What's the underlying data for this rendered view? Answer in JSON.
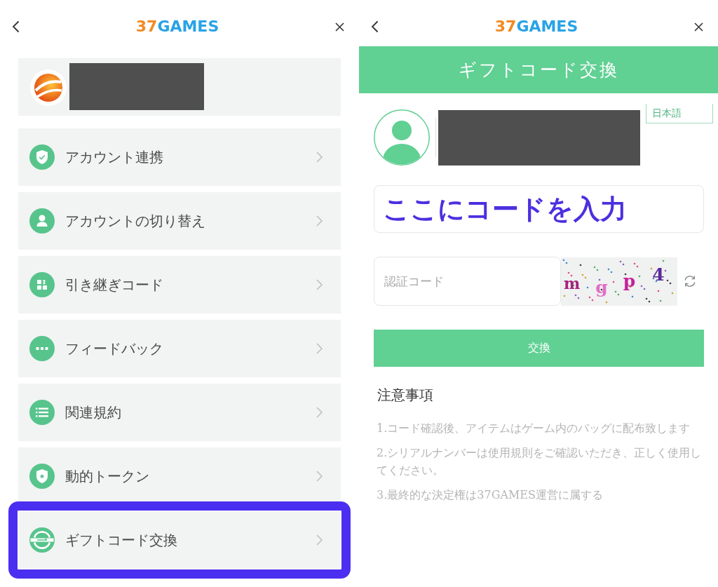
{
  "left_screen": {
    "header": {
      "logo": {
        "number": "37",
        "word": "GAMES"
      }
    },
    "menu_items": [
      {
        "label": "アカウント連携",
        "highlighted": false
      },
      {
        "label": "アカウントの切り替え",
        "highlighted": false
      },
      {
        "label": "引き継ぎコード",
        "highlighted": false
      },
      {
        "label": "フィードバック",
        "highlighted": false
      },
      {
        "label": "関連規約",
        "highlighted": false
      },
      {
        "label": "動的トークン",
        "highlighted": false
      },
      {
        "label": "ギフトコード交換",
        "highlighted": true
      }
    ]
  },
  "right_screen": {
    "header": {
      "logo": {
        "number": "37",
        "word": "GAMES"
      }
    },
    "title": "ギフトコード交換",
    "language": "日本語",
    "code_field": {
      "annotation": "ここにコードを入力"
    },
    "captcha_field": {
      "placeholder": "認証コード"
    },
    "captcha": {
      "chars": [
        {
          "text": "m",
          "color": "#a3237c"
        },
        {
          "text": "g",
          "color": "#e26ec6"
        },
        {
          "text": "p",
          "color": "#c5219a"
        },
        {
          "text": "4",
          "color": "#5b2c9c"
        }
      ]
    },
    "exchange_button": "交換",
    "notes": {
      "title": "注意事項",
      "items": [
        "1.コード確認後、アイテムはゲーム内のバッグに配布致します",
        "2.シリアルナンバーは使用規則をご確認いただき、正しく使用してください。",
        "3.最終的な決定権は37GAMES運営に属する"
      ]
    }
  }
}
